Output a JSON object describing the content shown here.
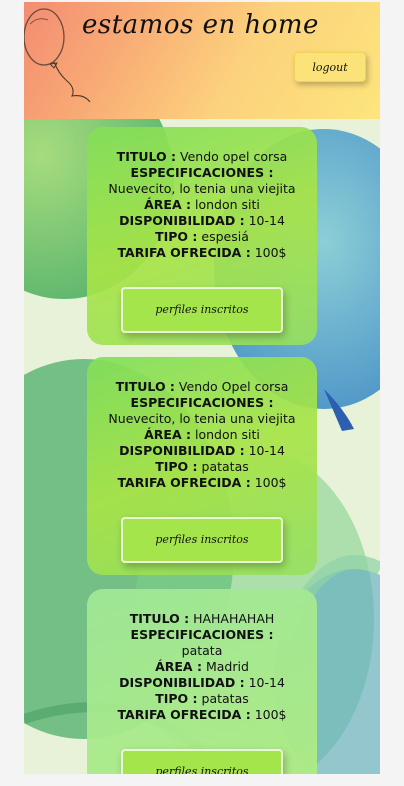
{
  "header": {
    "title": "estamos en home",
    "logout_label": "logout"
  },
  "labels": {
    "titulo": "TITULO :",
    "especificaciones": "ESPECIFICACIONES :",
    "area": "ÁREA :",
    "disponibilidad": "DISPONIBILIDAD :",
    "tipo": "TIPO :",
    "tarifa": "TARIFA OFRECIDA :"
  },
  "cards": [
    {
      "titulo": "Vendo opel corsa",
      "especificaciones": "Nuevecito, lo tenia una viejita",
      "area": "london siti",
      "disponibilidad": "10-14",
      "tipo": "espesiá",
      "tarifa": "100$",
      "button_label": "perfiles inscritos"
    },
    {
      "titulo": "Vendo Opel corsa",
      "especificaciones": "Nuevecito, lo tenia una viejita",
      "area": "london siti",
      "disponibilidad": "10-14",
      "tipo": "patatas",
      "tarifa": "100$",
      "button_label": "perfiles inscritos"
    },
    {
      "titulo": "HAHAHAHAH",
      "especificaciones": "patata",
      "area": "Madrid",
      "disponibilidad": "10-14",
      "tipo": "patatas",
      "tarifa": "100$",
      "button_label": "perfiles inscritos"
    }
  ]
}
